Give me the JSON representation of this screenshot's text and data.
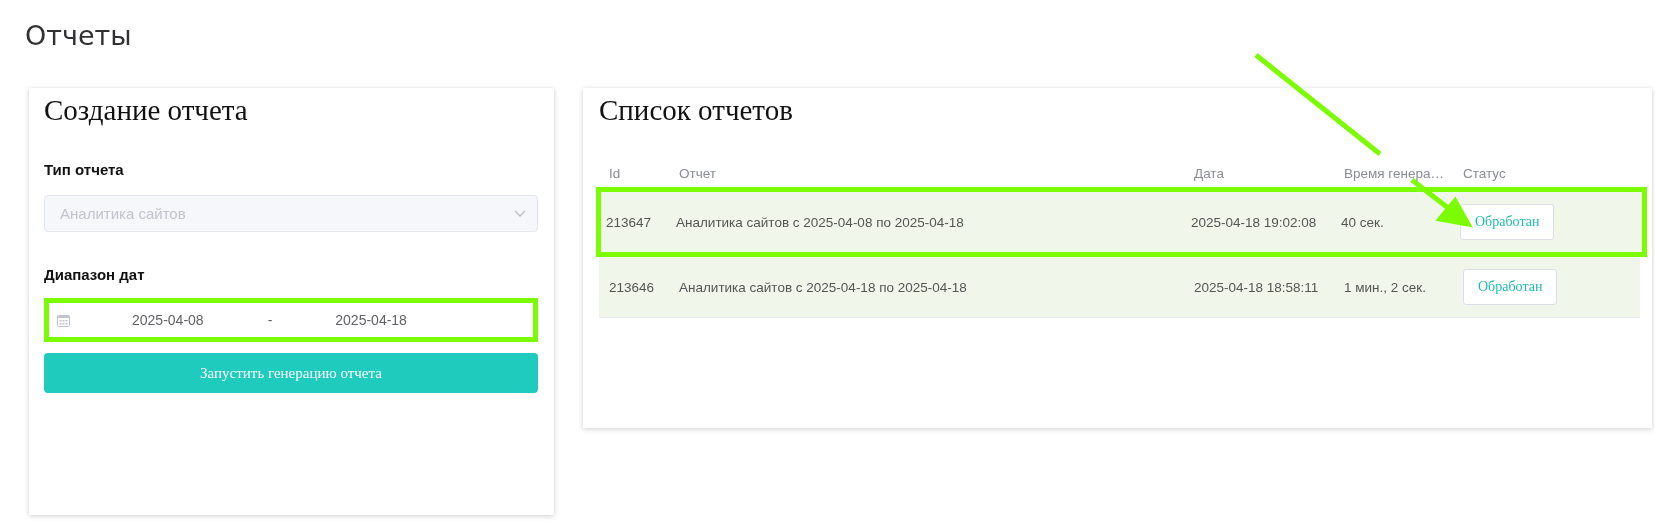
{
  "page_title": "Отчеты",
  "create_panel": {
    "title": "Создание отчета",
    "report_type": {
      "label": "Тип отчета",
      "value": "Аналитика сайтов",
      "disabled": true
    },
    "date_range": {
      "label": "Диапазон дат",
      "start": "2025-04-08",
      "separator": "-",
      "end": "2025-04-18",
      "highlighted": true
    },
    "submit_button": "Запустить генерацию отчета"
  },
  "list_panel": {
    "title": "Список отчетов",
    "columns": [
      "Id",
      "Отчет",
      "Дата",
      "Время генера…",
      "Статус"
    ],
    "rows": [
      {
        "id": "213647",
        "report": "Аналитика сайтов с 2025-04-08 по 2025-04-18",
        "date": "2025-04-18 19:02:08",
        "duration": "40 сек.",
        "status": "Обработан",
        "highlighted": true
      },
      {
        "id": "213646",
        "report": "Аналитика сайтов с 2025-04-18 по 2025-04-18",
        "date": "2025-04-18 18:58:11",
        "duration": "1 мин., 2 сек.",
        "status": "Обработан",
        "highlighted": false
      }
    ]
  },
  "annotations": {
    "arrow": true
  }
}
